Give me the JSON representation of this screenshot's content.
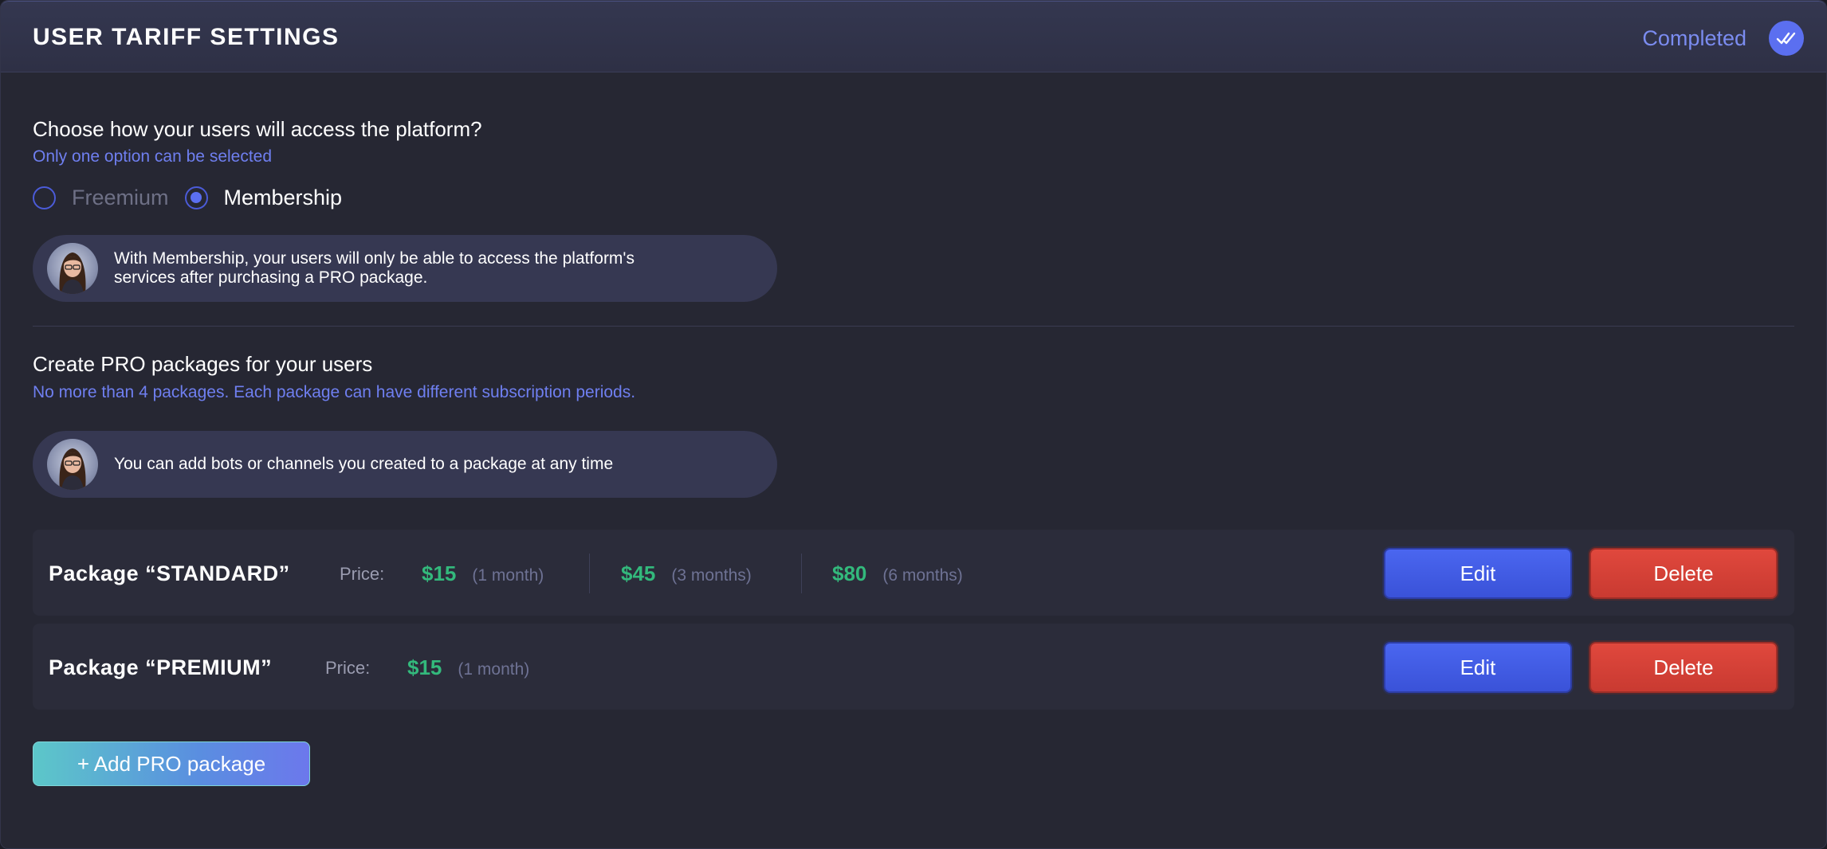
{
  "header": {
    "title": "USER TARIFF SETTINGS",
    "status": "Completed",
    "status_icon": "double-check-icon",
    "accent_color": "#5b6ff0"
  },
  "access": {
    "question": "Choose how your users will access the platform?",
    "hint": "Only one option can be selected",
    "options": [
      {
        "label": "Freemium",
        "selected": false
      },
      {
        "label": "Membership",
        "selected": true
      }
    ],
    "info_line1": "With Membership, your users will only be able to access the platform's",
    "info_line2": "services after purchasing a PRO package."
  },
  "packages_section": {
    "title": "Create PRO packages for your users",
    "hint": "No more than 4 packages. Each package can have different subscription periods.",
    "info": "You can add bots or channels you created to a package at any time"
  },
  "packages": [
    {
      "name": "Package “STANDARD”",
      "price_label": "Price:",
      "prices": [
        {
          "value": "$15",
          "period": "(1 month)"
        },
        {
          "value": "$45",
          "period": "(3 months)"
        },
        {
          "value": "$80",
          "period": "(6 months)"
        }
      ],
      "edit_label": "Edit",
      "delete_label": "Delete"
    },
    {
      "name": "Package “PREMIUM”",
      "price_label": "Price:",
      "prices": [
        {
          "value": "$15",
          "period": "(1 month)"
        }
      ],
      "edit_label": "Edit",
      "delete_label": "Delete"
    }
  ],
  "add_button": {
    "label": "+ Add PRO package"
  },
  "colors": {
    "price_green": "#33b97c",
    "edit_blue": "#4a66f0",
    "delete_red": "#e0483d",
    "hint_blue": "#6f7ff0"
  }
}
